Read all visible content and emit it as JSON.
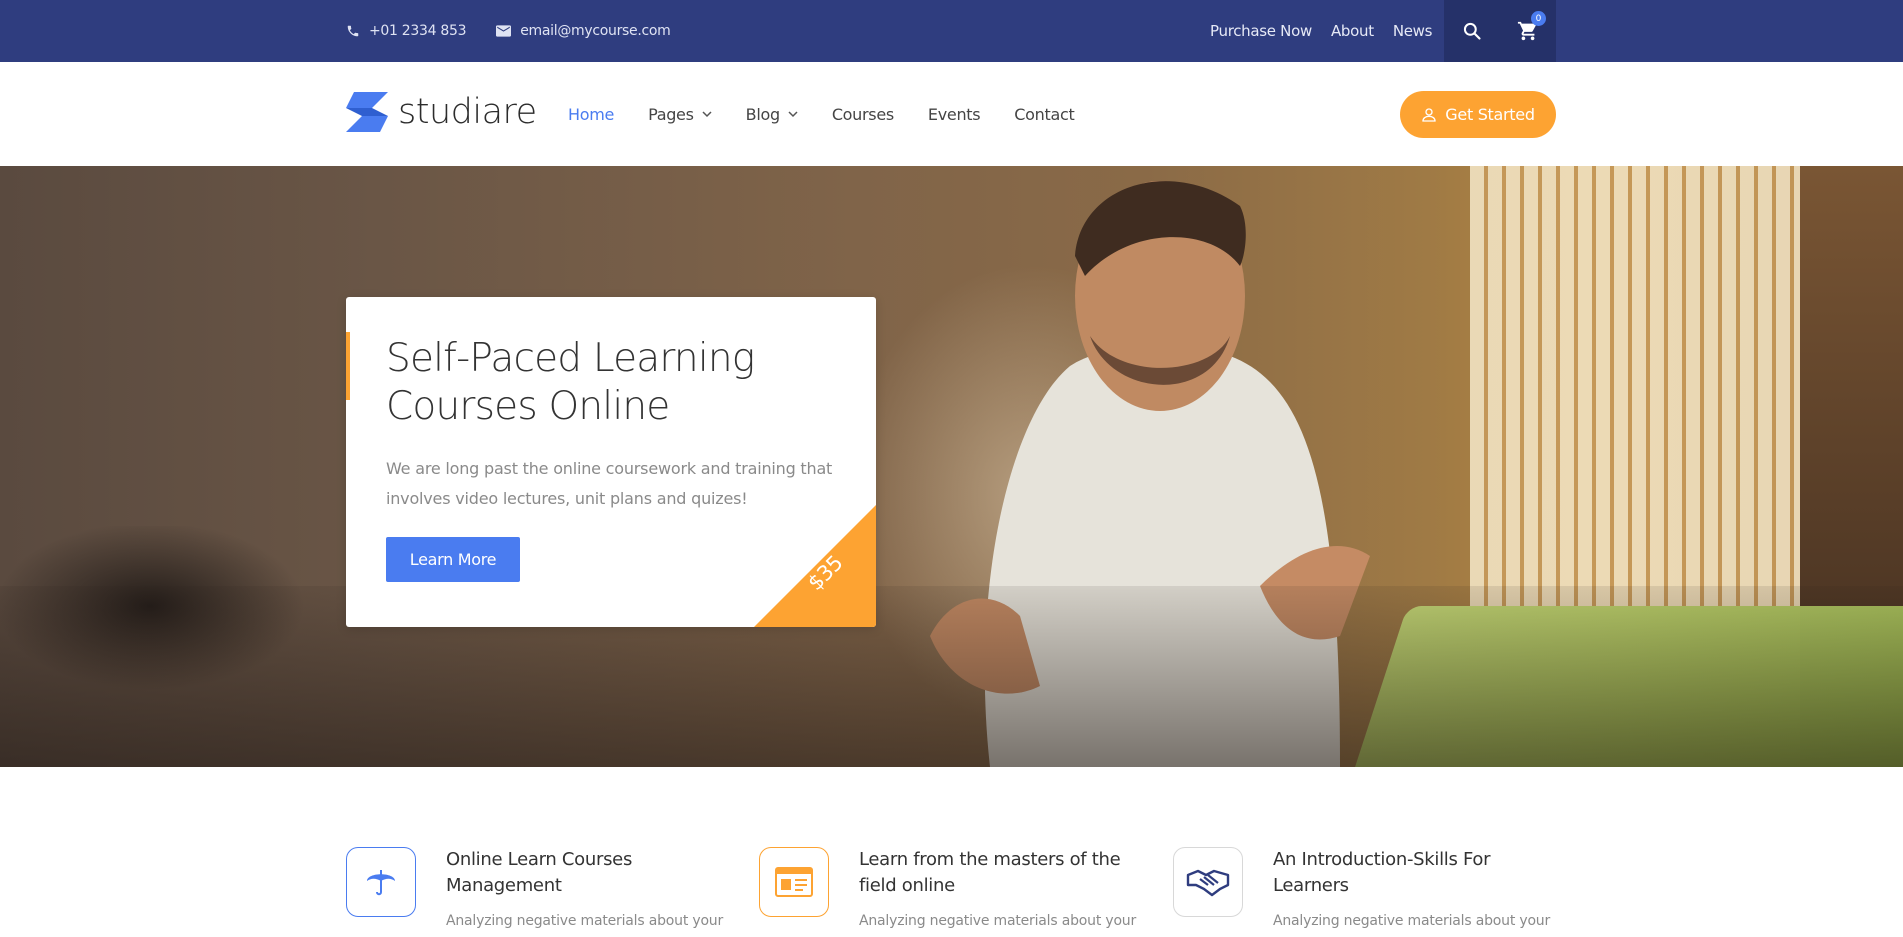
{
  "topbar": {
    "phone": "+01 2334 853",
    "email": "email@mycourse.com",
    "links": [
      "Purchase Now",
      "About",
      "News"
    ],
    "cart_count": "0"
  },
  "header": {
    "logo_text": "studiare",
    "nav": [
      {
        "label": "Home",
        "active": true
      },
      {
        "label": "Pages",
        "dropdown": true
      },
      {
        "label": "Blog",
        "dropdown": true
      },
      {
        "label": "Courses"
      },
      {
        "label": "Events"
      },
      {
        "label": "Contact"
      }
    ],
    "cta_label": "Get Started"
  },
  "hero": {
    "title": "Self-Paced Learning Courses Online",
    "text": "We are long past the online coursework and training that involves video lectures, unit plans and quizes!",
    "button_label": "Learn More",
    "price": "$35"
  },
  "features": [
    {
      "icon": "umbrella-icon",
      "title": "Online Learn Courses Management",
      "text": "Analyzing negative materials about your",
      "color": "#4a7cf0"
    },
    {
      "icon": "id-card-icon",
      "title": "Learn from the masters of the field online",
      "text": "Analyzing negative materials about your",
      "color": "#fda332"
    },
    {
      "icon": "handshake-icon",
      "title": "An Introduction-Skills For Learners",
      "text": "Analyzing negative materials about your",
      "color": "#2f3d7f"
    }
  ],
  "colors": {
    "topbar": "#2f3d7f",
    "accent_blue": "#4a7cf0",
    "accent_orange": "#fda332"
  }
}
